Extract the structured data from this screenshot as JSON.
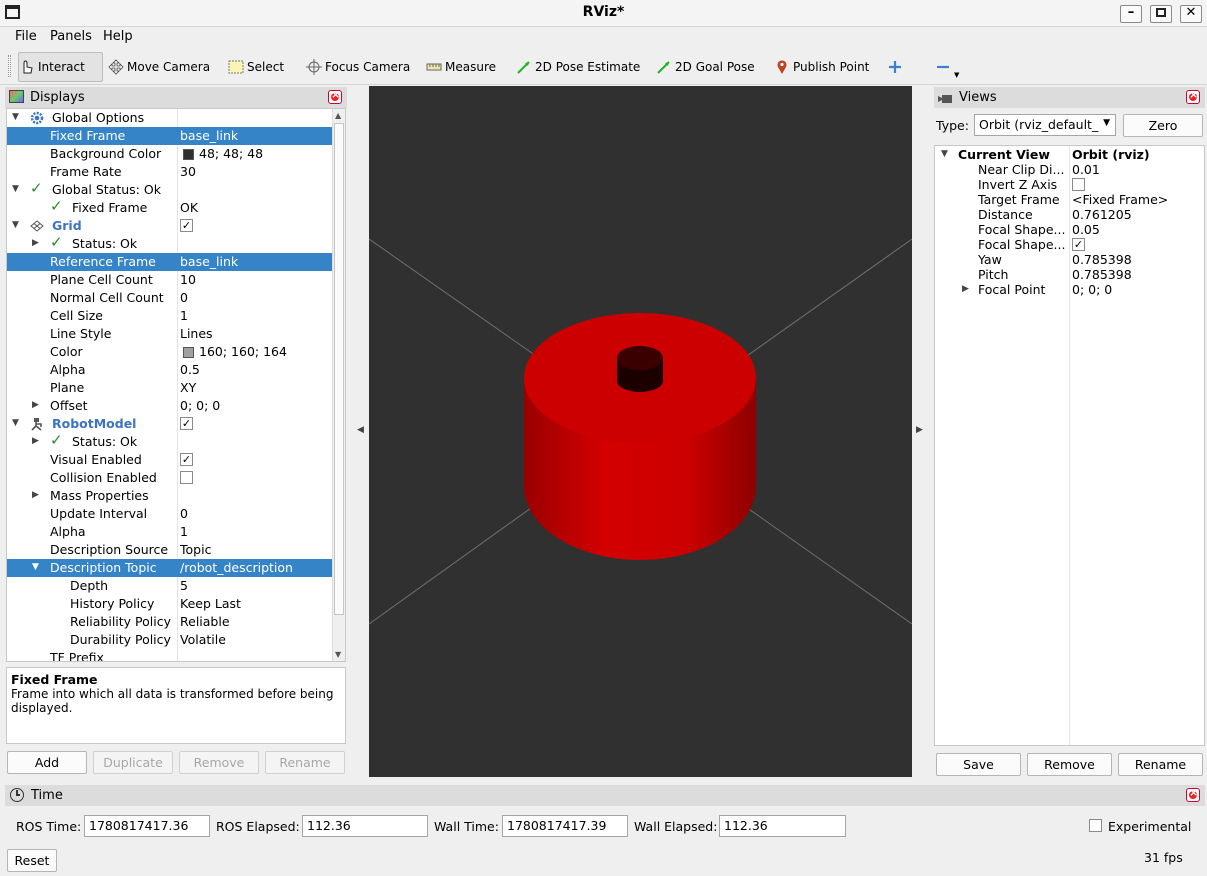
{
  "window": {
    "title": "RViz*"
  },
  "menu": [
    "File",
    "Panels",
    "Help"
  ],
  "toolbar": {
    "interact": "Interact",
    "move_camera": "Move Camera",
    "select": "Select",
    "focus_camera": "Focus Camera",
    "measure": "Measure",
    "pose_estimate": "2D Pose Estimate",
    "goal_pose": "2D Goal Pose",
    "publish_point": "Publish Point"
  },
  "displays": {
    "title": "Displays",
    "rows": [
      {
        "name": "Global Options",
        "value": ""
      },
      {
        "name": "Fixed Frame",
        "value": "base_link"
      },
      {
        "name": "Background Color",
        "value": "48; 48; 48"
      },
      {
        "name": "Frame Rate",
        "value": "30"
      },
      {
        "name": "Global Status: Ok",
        "value": ""
      },
      {
        "name": "Fixed Frame",
        "value": "OK"
      },
      {
        "name": "Grid",
        "value": ""
      },
      {
        "name": "Status: Ok",
        "value": ""
      },
      {
        "name": "Reference Frame",
        "value": "base_link"
      },
      {
        "name": "Plane Cell Count",
        "value": "10"
      },
      {
        "name": "Normal Cell Count",
        "value": "0"
      },
      {
        "name": "Cell Size",
        "value": "1"
      },
      {
        "name": "Line Style",
        "value": "Lines"
      },
      {
        "name": "Color",
        "value": "160; 160; 164"
      },
      {
        "name": "Alpha",
        "value": "0.5"
      },
      {
        "name": "Plane",
        "value": "XY"
      },
      {
        "name": "Offset",
        "value": "0; 0; 0"
      },
      {
        "name": "RobotModel",
        "value": ""
      },
      {
        "name": "Status: Ok",
        "value": ""
      },
      {
        "name": "Visual Enabled",
        "value": ""
      },
      {
        "name": "Collision Enabled",
        "value": ""
      },
      {
        "name": "Mass Properties",
        "value": ""
      },
      {
        "name": "Update Interval",
        "value": "0"
      },
      {
        "name": "Alpha",
        "value": "1"
      },
      {
        "name": "Description Source",
        "value": "Topic"
      },
      {
        "name": "Description Topic",
        "value": "/robot_description"
      },
      {
        "name": "Depth",
        "value": "5"
      },
      {
        "name": "History Policy",
        "value": "Keep Last"
      },
      {
        "name": "Reliability Policy",
        "value": "Reliable"
      },
      {
        "name": "Durability Policy",
        "value": "Volatile"
      },
      {
        "name": "TF Prefix",
        "value": ""
      }
    ],
    "description_title": "Fixed Frame",
    "description_text": "Frame into which all data is transformed before being displayed.",
    "buttons": {
      "add": "Add",
      "duplicate": "Duplicate",
      "remove": "Remove",
      "rename": "Rename"
    }
  },
  "views": {
    "title": "Views",
    "type_label": "Type:",
    "type_value": "Orbit (rviz_default_",
    "zero": "Zero",
    "rows": [
      {
        "name": "Current View",
        "value": "Orbit (rviz)"
      },
      {
        "name": "Near Clip Di...",
        "value": "0.01"
      },
      {
        "name": "Invert Z Axis",
        "value": ""
      },
      {
        "name": "Target Frame",
        "value": "<Fixed Frame>"
      },
      {
        "name": "Distance",
        "value": "0.761205"
      },
      {
        "name": "Focal Shape...",
        "value": "0.05"
      },
      {
        "name": "Focal Shape...",
        "value": ""
      },
      {
        "name": "Yaw",
        "value": "0.785398"
      },
      {
        "name": "Pitch",
        "value": "0.785398"
      },
      {
        "name": "Focal Point",
        "value": "0; 0; 0"
      }
    ],
    "buttons": {
      "save": "Save",
      "remove": "Remove",
      "rename": "Rename"
    }
  },
  "time": {
    "title": "Time",
    "ros_time_label": "ROS Time:",
    "ros_time": "1780817417.36",
    "ros_elapsed_label": "ROS Elapsed:",
    "ros_elapsed": "112.36",
    "wall_time_label": "Wall Time:",
    "wall_time": "1780817417.39",
    "wall_elapsed_label": "Wall Elapsed:",
    "wall_elapsed": "112.36",
    "experimental": "Experimental",
    "reset": "Reset",
    "fps": "31 fps"
  },
  "colors": {
    "selection": "#3584c7",
    "background": "#303030",
    "cylinder": "#c80000"
  }
}
